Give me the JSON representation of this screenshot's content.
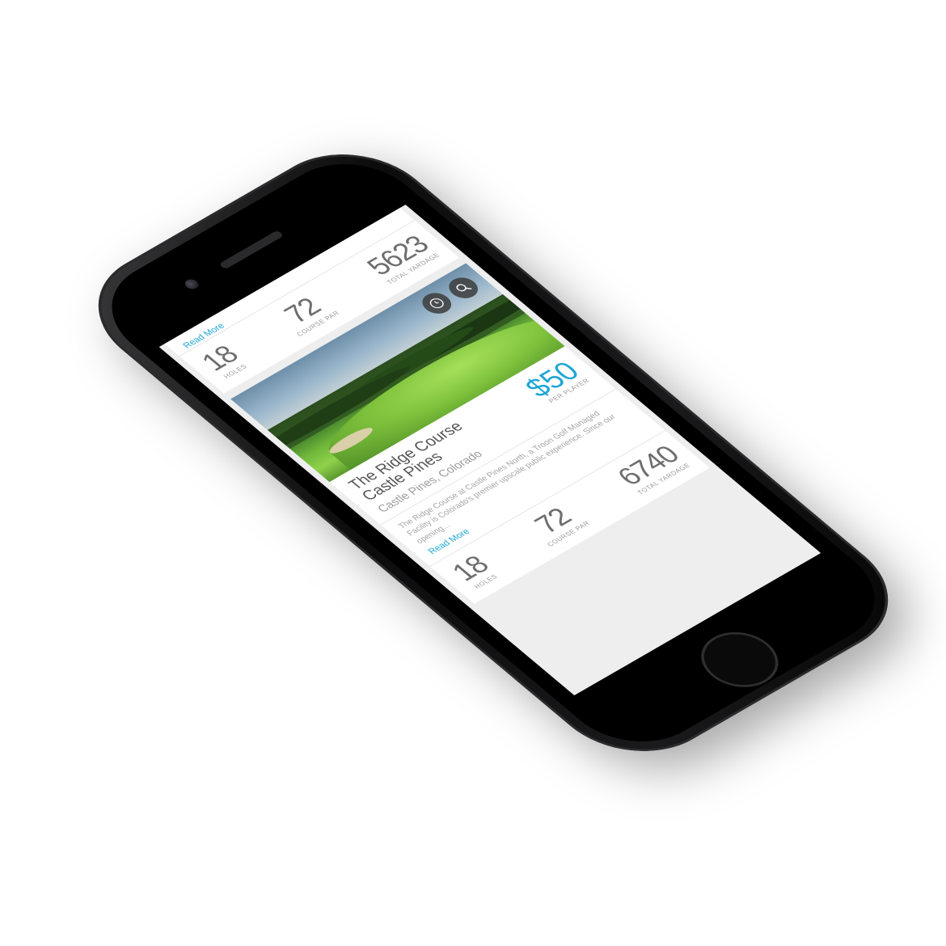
{
  "previous_course": {
    "read_more": "Read More",
    "holes": {
      "value": "18",
      "label": "HOLES"
    },
    "par": {
      "value": "72",
      "label": "COURSE PAR"
    },
    "yardage": {
      "value": "5623",
      "label": "TOTAL YARDAGE"
    }
  },
  "course": {
    "title_line1": "The Ridge Course",
    "title_line2": "Castle Pines",
    "location": "Castle Pines, Colorado",
    "price": "$50",
    "price_label": "PER PLAYER",
    "description": "The Ridge Course at Castle Pines North, a Troon Golf Managed Facility is Colorado's premier upscale public experience. Since our opening...",
    "read_more": "Read More",
    "holes": {
      "value": "18",
      "label": "HOLES"
    },
    "par": {
      "value": "72",
      "label": "COURSE PAR"
    },
    "yardage": {
      "value": "6740",
      "label": "TOTAL YARDAGE"
    }
  },
  "icons": {
    "tee_time": "clock-icon",
    "search": "search-icon"
  },
  "colors": {
    "accent": "#1ea7d6",
    "phone_body": "#111111"
  }
}
